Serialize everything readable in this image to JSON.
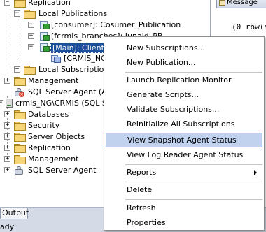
{
  "tree": {
    "replication_top": "Replication",
    "local_publications": "Local Publications",
    "pub_consumer": "[consumer]: Cosumer_Publication",
    "pub_fcrmis": "[fcrmis_branches]: Junaid_PB",
    "pub_main": "[Main]: Client_Pu",
    "sub_crmis": "[CRMIS_NG\\C",
    "local_subscriptions": "Local Subscriptions",
    "management_1": "Management",
    "agent_1": "SQL Server Agent (Agen",
    "server_node": "crmis_NG\\CRMIS (SQL Server",
    "databases": "Databases",
    "security": "Security",
    "server_objects": "Server Objects",
    "replication_2": "Replication",
    "management_2": "Management",
    "agent_2": "SQL Server Agent",
    "expand_plus": "+",
    "expand_minus": "−"
  },
  "right_pane": {
    "tab_label": "Message",
    "message_text": "(0 row(s"
  },
  "bottom": {
    "output_tab": "Output",
    "status_text": "ady"
  },
  "context_menu": {
    "items": [
      {
        "label": "New Subscriptions..."
      },
      {
        "label": "New Publication..."
      },
      {
        "label": "Launch Replication Monitor"
      },
      {
        "label": "Generate Scripts..."
      },
      {
        "label": "Validate Subscriptions..."
      },
      {
        "label": "Reinitialize All Subscriptions"
      },
      {
        "label": "View Snapshot Agent Status"
      },
      {
        "label": "View Log Reader Agent Status"
      },
      {
        "label": "Reports"
      },
      {
        "label": "Delete"
      },
      {
        "label": "Refresh"
      },
      {
        "label": "Properties"
      }
    ]
  }
}
